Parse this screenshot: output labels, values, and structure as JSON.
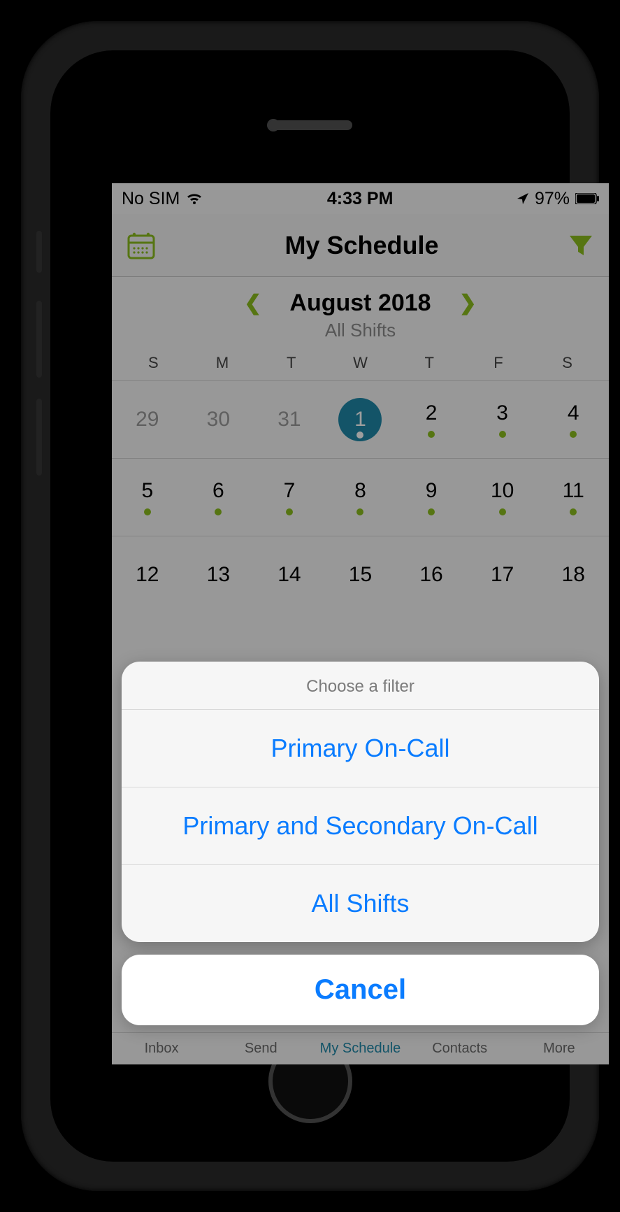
{
  "colors": {
    "accent_green": "#8bbd1d",
    "accent_blue": "#1f88a8",
    "ios_blue": "#0a7cff"
  },
  "status": {
    "carrier": "No SIM",
    "time": "4:33 PM",
    "battery_pct": "97%"
  },
  "header": {
    "title": "My Schedule"
  },
  "month_nav": {
    "label": "August 2018",
    "subtitle": "All Shifts"
  },
  "weekdays": [
    "S",
    "M",
    "T",
    "W",
    "T",
    "F",
    "S"
  ],
  "calendar": {
    "rows": [
      [
        {
          "n": "29",
          "muted": true,
          "dot": false,
          "selected": false
        },
        {
          "n": "30",
          "muted": true,
          "dot": false,
          "selected": false
        },
        {
          "n": "31",
          "muted": true,
          "dot": false,
          "selected": false
        },
        {
          "n": "1",
          "muted": false,
          "dot": true,
          "selected": true
        },
        {
          "n": "2",
          "muted": false,
          "dot": true,
          "selected": false
        },
        {
          "n": "3",
          "muted": false,
          "dot": true,
          "selected": false
        },
        {
          "n": "4",
          "muted": false,
          "dot": true,
          "selected": false
        }
      ],
      [
        {
          "n": "5",
          "muted": false,
          "dot": true,
          "selected": false
        },
        {
          "n": "6",
          "muted": false,
          "dot": true,
          "selected": false
        },
        {
          "n": "7",
          "muted": false,
          "dot": true,
          "selected": false
        },
        {
          "n": "8",
          "muted": false,
          "dot": true,
          "selected": false
        },
        {
          "n": "9",
          "muted": false,
          "dot": true,
          "selected": false
        },
        {
          "n": "10",
          "muted": false,
          "dot": true,
          "selected": false
        },
        {
          "n": "11",
          "muted": false,
          "dot": true,
          "selected": false
        }
      ],
      [
        {
          "n": "12",
          "muted": false,
          "dot": false,
          "selected": false
        },
        {
          "n": "13",
          "muted": false,
          "dot": false,
          "selected": false
        },
        {
          "n": "14",
          "muted": false,
          "dot": false,
          "selected": false
        },
        {
          "n": "15",
          "muted": false,
          "dot": false,
          "selected": false
        },
        {
          "n": "16",
          "muted": false,
          "dot": false,
          "selected": false
        },
        {
          "n": "17",
          "muted": false,
          "dot": false,
          "selected": false
        },
        {
          "n": "18",
          "muted": false,
          "dot": false,
          "selected": false
        }
      ]
    ]
  },
  "sheet": {
    "title": "Choose a filter",
    "options": [
      "Primary On-Call",
      "Primary and Secondary On-Call",
      "All Shifts"
    ],
    "cancel": "Cancel"
  },
  "tabs": [
    "Inbox",
    "Send",
    "My Schedule",
    "Contacts",
    "More"
  ],
  "tabs_active_index": 2
}
